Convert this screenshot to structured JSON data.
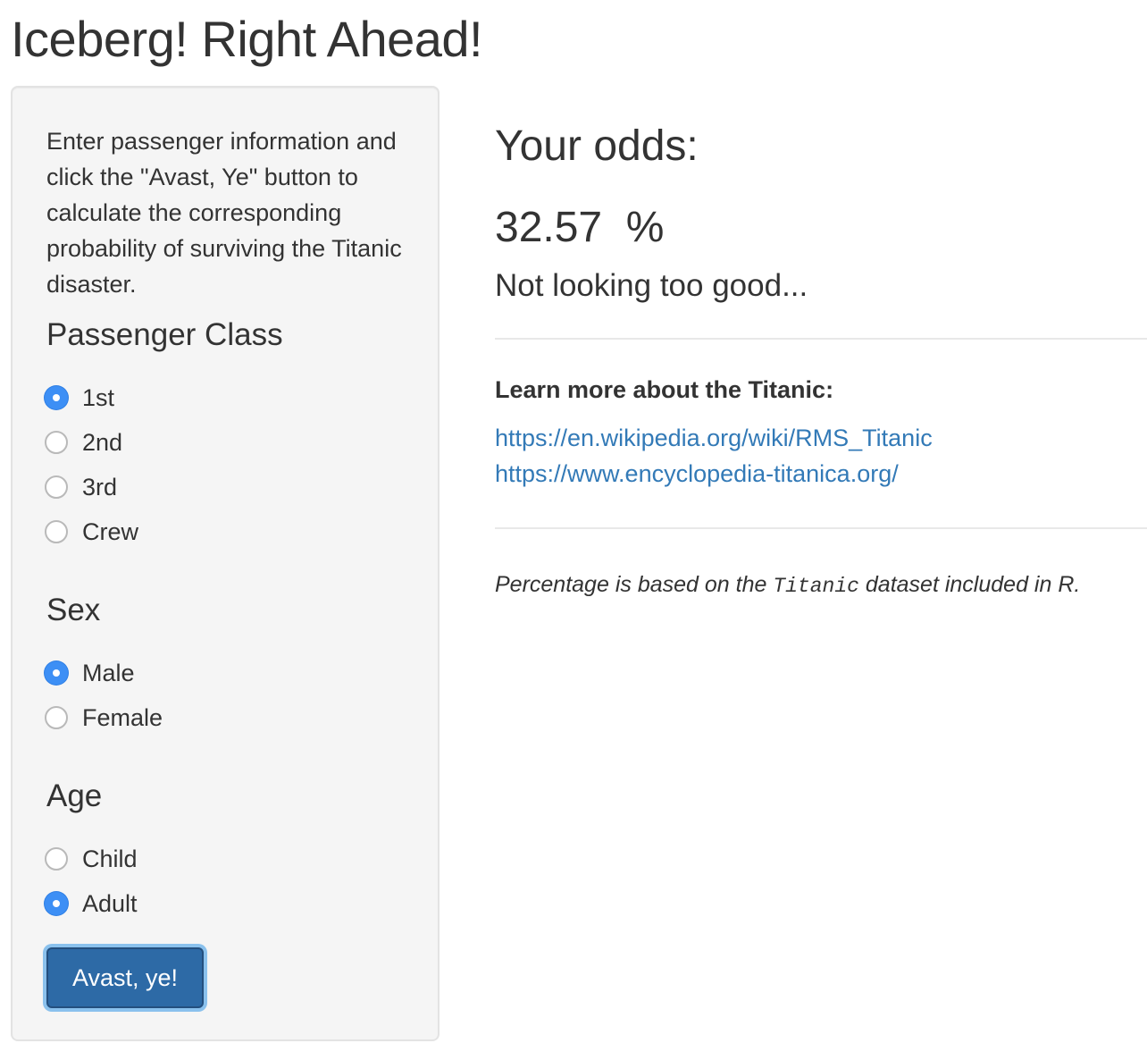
{
  "page": {
    "title": "Iceberg! Right Ahead!"
  },
  "sidebar": {
    "intro": "Enter passenger information and click the \"Avast, Ye\" button to calculate the corresponding probability of surviving the Titanic disaster.",
    "passenger_class": {
      "title": "Passenger Class",
      "options": [
        {
          "label": "1st",
          "checked": true
        },
        {
          "label": "2nd",
          "checked": false
        },
        {
          "label": "3rd",
          "checked": false
        },
        {
          "label": "Crew",
          "checked": false
        }
      ]
    },
    "sex": {
      "title": "Sex",
      "options": [
        {
          "label": "Male",
          "checked": true
        },
        {
          "label": "Female",
          "checked": false
        }
      ]
    },
    "age": {
      "title": "Age",
      "options": [
        {
          "label": "Child",
          "checked": false
        },
        {
          "label": "Adult",
          "checked": true
        }
      ]
    },
    "submit_label": "Avast, ye!"
  },
  "main": {
    "odds_heading": "Your odds:",
    "odds_value": "32.57  %",
    "odds_verdict": "Not looking too good...",
    "learn_heading": "Learn more about the Titanic:",
    "links": [
      "https://en.wikipedia.org/wiki/RMS_Titanic",
      "https://www.encyclopedia-titanica.org/"
    ],
    "footnote": {
      "before": "Percentage is based on the ",
      "code": "Titanic",
      "after": " dataset included in R."
    }
  },
  "colors": {
    "accent": "#3d8ff5",
    "button": "#2d6aa6",
    "link": "#337ab7",
    "panel": "#f5f5f5"
  }
}
